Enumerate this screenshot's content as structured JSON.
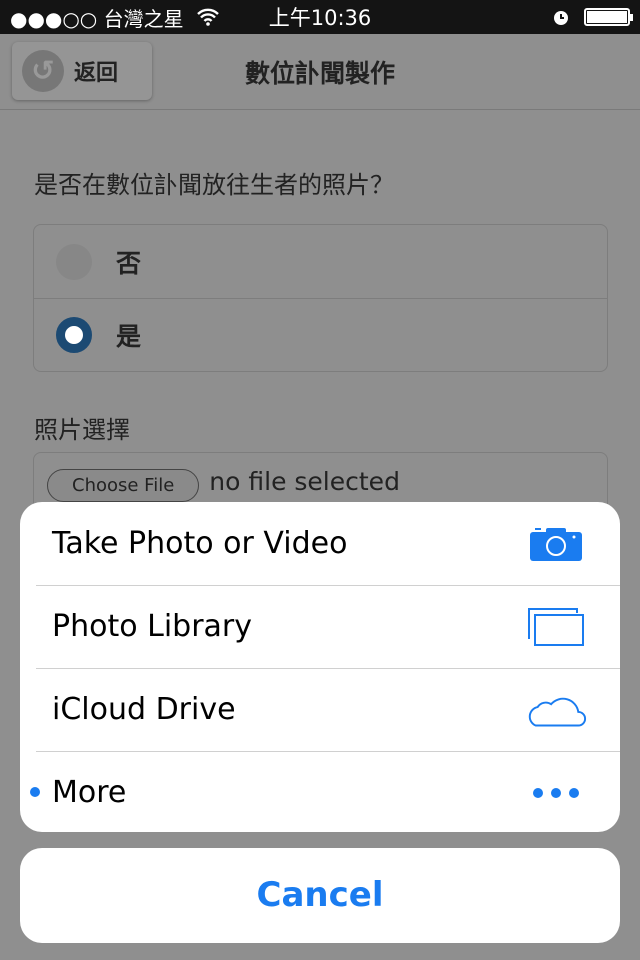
{
  "status": {
    "carrier": "●●●○○ 台灣之星",
    "time": "上午10:36"
  },
  "nav": {
    "back_label": "返回",
    "title": "數位訃聞製作"
  },
  "form": {
    "question": "是否在數位訃聞放往生者的照片？",
    "options": [
      {
        "label": "否",
        "selected": false
      },
      {
        "label": "是",
        "selected": true
      }
    ],
    "photo_label": "照片選擇",
    "choose_file": "Choose File",
    "file_status": "no file selected"
  },
  "sheet": {
    "items": [
      {
        "label": "Take Photo or Video",
        "icon": "camera-icon"
      },
      {
        "label": "Photo Library",
        "icon": "photo-library-icon"
      },
      {
        "label": "iCloud Drive",
        "icon": "cloud-icon"
      },
      {
        "label": "More",
        "icon": "more-icon"
      }
    ],
    "cancel": "Cancel"
  },
  "colors": {
    "accent": "#1a7cf0"
  }
}
